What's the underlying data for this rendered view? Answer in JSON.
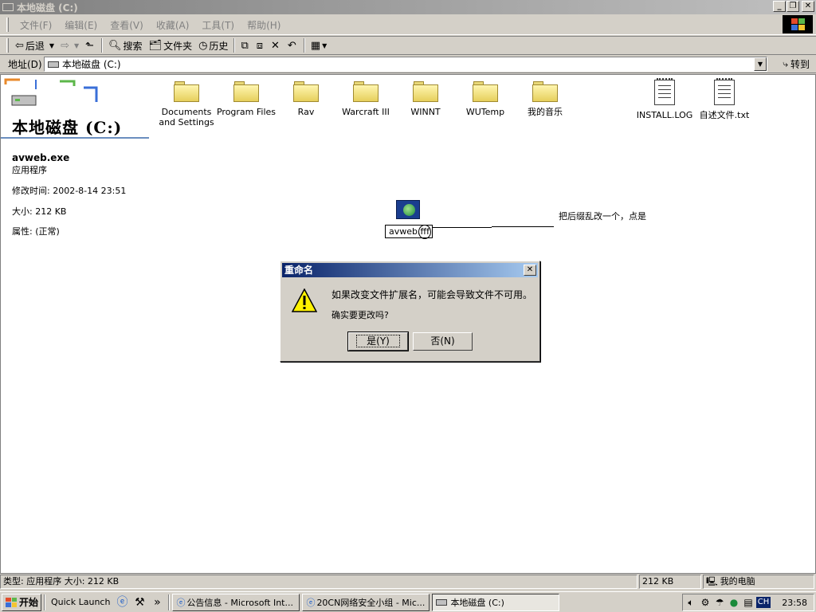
{
  "window": {
    "title": "本地磁盘 (C:)"
  },
  "menu": [
    "文件(F)",
    "编辑(E)",
    "查看(V)",
    "收藏(A)",
    "工具(T)",
    "帮助(H)"
  ],
  "toolbar": {
    "back": "后退",
    "search": "搜索",
    "folders": "文件夹",
    "history": "历史"
  },
  "address": {
    "label": "地址(D)",
    "value": "本地磁盘 (C:)",
    "go": "转到"
  },
  "pane": {
    "title": "本地磁盘 (C:)",
    "file_name": "avweb.exe",
    "file_type": "应用程序",
    "modified_label": "修改时间:",
    "modified_value": "2002-8-14 23:51",
    "size_label": "大小:",
    "size_value": "212 KB",
    "attr_label": "属性:",
    "attr_value": "(正常)"
  },
  "items": {
    "folders": [
      "Documents and Settings",
      "Program Files",
      "Rav",
      "Warcraft III",
      "WINNT",
      "WUTemp",
      "我的音乐"
    ],
    "files": [
      "INSTALL.LOG",
      "自述文件.txt"
    ]
  },
  "rename": {
    "value": "avweb.fff",
    "annotation": "把后缀乱改一个，点是"
  },
  "dialog": {
    "title": "重命名",
    "message1": "如果改变文件扩展名，可能会导致文件不可用。",
    "message2": "确实要更改吗?",
    "yes": "是(Y)",
    "no": "否(N)"
  },
  "status": {
    "left": "类型: 应用程序 大小: 212 KB",
    "size": "212 KB",
    "location": "我的电脑"
  },
  "taskbar": {
    "start": "开始",
    "quick_launch": "Quick Launch",
    "chevron": "»",
    "tasks": [
      "公告信息 - Microsoft Int...",
      "20CN网络安全小组 - Mic...",
      "本地磁盘 (C:)"
    ],
    "ime": "CH",
    "clock": "23:58"
  }
}
